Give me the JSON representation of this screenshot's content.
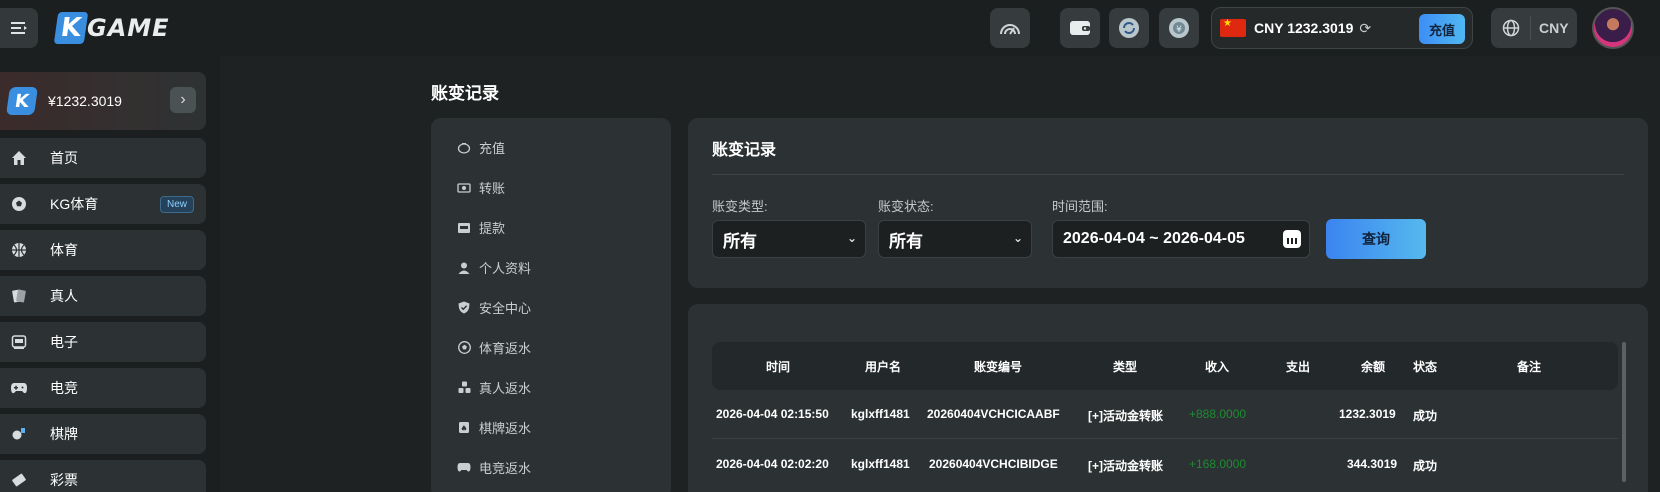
{
  "header": {
    "logo_k": "K",
    "logo_text": "GAME",
    "balance": "CNY 1232.3019",
    "recharge_label": "充值",
    "currency": "CNY"
  },
  "sidebar": {
    "wallet_amount": "¥1232.3019",
    "wallet_logo": "K",
    "items": [
      {
        "label": "首页",
        "icon": "home-icon"
      },
      {
        "label": "KG体育",
        "icon": "soccer-ball-icon",
        "badge": "New"
      },
      {
        "label": "体育",
        "icon": "basketball-icon"
      },
      {
        "label": "真人",
        "icon": "cards-icon"
      },
      {
        "label": "电子",
        "icon": "slot-machine-icon"
      },
      {
        "label": "电竞",
        "icon": "gamepad-icon"
      },
      {
        "label": "棋牌",
        "icon": "chess-icon"
      },
      {
        "label": "彩票",
        "icon": "lottery-ticket-icon"
      }
    ]
  },
  "page_title": "账变记录",
  "side_menu": [
    {
      "label": "充值",
      "icon": "piggy-bank-icon"
    },
    {
      "label": "转账",
      "icon": "transfer-icon"
    },
    {
      "label": "提款",
      "icon": "withdraw-icon"
    },
    {
      "label": "个人资料",
      "icon": "user-icon"
    },
    {
      "label": "安全中心",
      "icon": "shield-icon"
    },
    {
      "label": "体育返水",
      "icon": "soccer-ball-icon"
    },
    {
      "label": "真人返水",
      "icon": "cards-icon"
    },
    {
      "label": "棋牌返水",
      "icon": "chess-icon"
    },
    {
      "label": "电竞返水",
      "icon": "gamepad-icon"
    }
  ],
  "filter": {
    "title": "账变记录",
    "type_label": "账变类型:",
    "type_value": "所有",
    "status_label": "账变状态:",
    "status_value": "所有",
    "time_label": "时间范围:",
    "date_range": "2026-04-04 ~ 2026-04-05",
    "query_label": "查询"
  },
  "table": {
    "columns": [
      "时间",
      "用户名",
      "账变编号",
      "类型",
      "收入",
      "支出",
      "余额",
      "状态",
      "备注"
    ],
    "rows": [
      {
        "time": "2026-04-04 02:15:50",
        "user": "kglxff1481",
        "id": "20260404VCHCICAABF",
        "type": "[+]活动金转账",
        "income": "+888.0000",
        "expense": "",
        "balance": "1232.3019",
        "status": "成功",
        "note": ""
      },
      {
        "time": "2026-04-04 02:02:20",
        "user": "kglxff1481",
        "id": "20260404VCHCIBIDGE",
        "type": "[+]活动金转账",
        "income": "+168.0000",
        "expense": "",
        "balance": "344.3019",
        "status": "成功",
        "note": ""
      }
    ]
  },
  "colors": {
    "accent": "#3d8ef5",
    "income_green": "#1f8a33",
    "panel": "#2c3233",
    "background": "#1e2223"
  }
}
